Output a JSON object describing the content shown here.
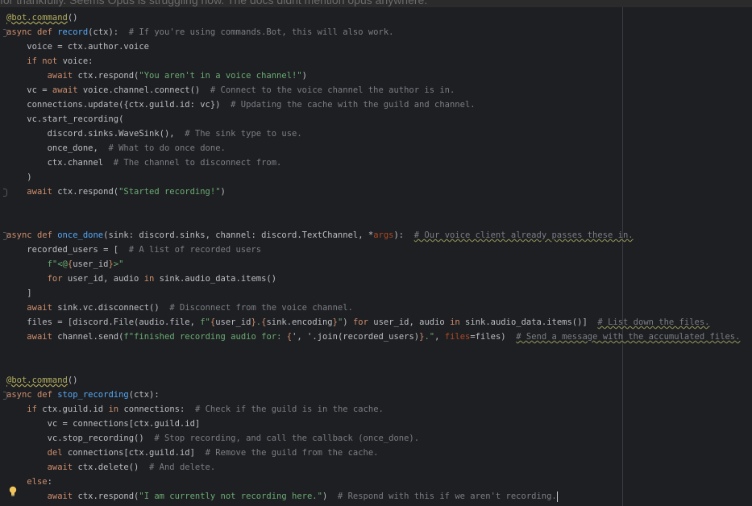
{
  "top_strip_text": "for thankfully. Seems Opus is struggling now. The docs didnt mention opus anywhere.",
  "code_lines": [
    "@bot.command()",
    "async def record(ctx):  # If you're using commands.Bot, this will also work.",
    "    voice = ctx.author.voice",
    "    if not voice:",
    "        await ctx.respond(\"You aren't in a voice channel!\")",
    "    vc = await voice.channel.connect()  # Connect to the voice channel the author is in.",
    "    connections.update({ctx.guild.id: vc})  # Updating the cache with the guild and channel.",
    "    vc.start_recording(",
    "        discord.sinks.WaveSink(),  # The sink type to use.",
    "        once_done,  # What to do once done.",
    "        ctx.channel  # The channel to disconnect from.",
    "    )",
    "    await ctx.respond(\"Started recording!\")",
    "",
    "",
    "async def once_done(sink: discord.sinks, channel: discord.TextChannel, *args):  # Our voice client already passes these in.",
    "    recorded_users = [  # A list of recorded users",
    "        f\"<@{user_id}>\"",
    "        for user_id, audio in sink.audio_data.items()",
    "    ]",
    "    await sink.vc.disconnect()  # Disconnect from the voice channel.",
    "    files = [discord.File(audio.file, f\"{user_id}.{sink.encoding}\") for user_id, audio in sink.audio_data.items()]  # List down the files.",
    "    await channel.send(f\"finished recording audio for: {', '.join(recorded_users)}.\", files=files)  # Send a message with the accumulated files.",
    "",
    "",
    "@bot.command()",
    "async def stop_recording(ctx):",
    "    if ctx.guild.id in connections:  # Check if the guild is in the cache.",
    "        vc = connections[ctx.guild.id]",
    "        vc.stop_recording()  # Stop recording, and call the callback (once_done).",
    "        del connections[ctx.guild.id]  # Remove the guild from the cache.",
    "        await ctx.delete()  # And delete.",
    "    else:",
    "        await ctx.respond(\"I am currently not recording here.\")  # Respond with this if we aren't recording."
  ],
  "colors": {
    "background": "#1e1f22",
    "keyword": "#cf8e6d",
    "function": "#56a8f5",
    "decorator": "#b3ae60",
    "string": "#6aab73",
    "comment": "#7a7e85",
    "default": "#bcbec4"
  },
  "icons": {
    "intention": "lightbulb-icon",
    "fold": "fold-marker-icon"
  }
}
